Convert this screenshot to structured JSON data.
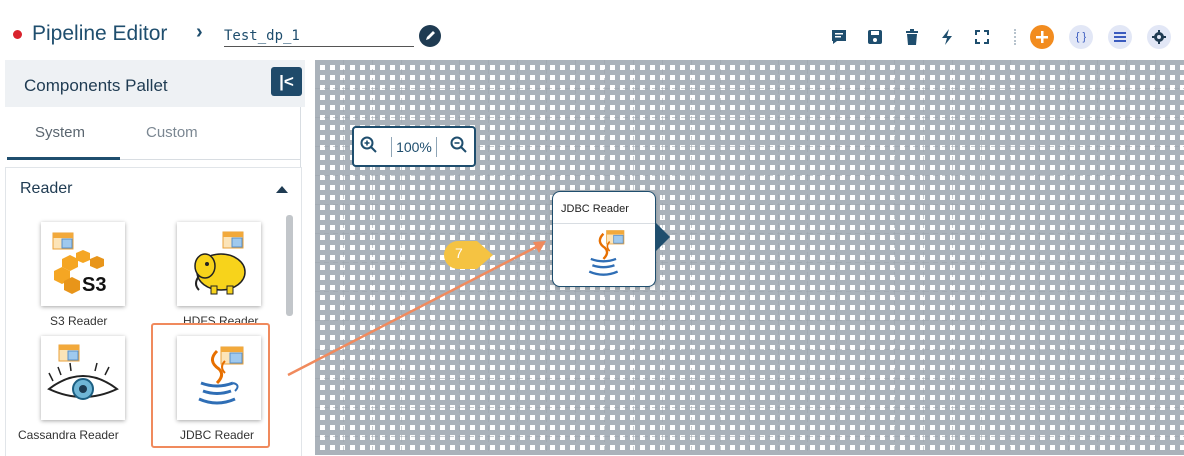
{
  "header": {
    "title": "Pipeline Editor",
    "pipeline_name": "Test_dp_1",
    "status_color": "#d9232d",
    "toolbar_icons": [
      "comment-icon",
      "save-icon",
      "delete-icon",
      "flash-icon",
      "fullscreen-icon",
      "add-icon",
      "json-icon",
      "list-icon",
      "settings-icon"
    ]
  },
  "sidebar": {
    "title": "Components Pallet",
    "collapse_label": "|<",
    "tabs": [
      {
        "label": "System",
        "active": true
      },
      {
        "label": "Custom",
        "active": false
      }
    ],
    "section_title": "Reader",
    "components": [
      {
        "label": "S3 Reader"
      },
      {
        "label": "HDFS Reader"
      },
      {
        "label": "Cassandra Reader"
      },
      {
        "label": "JDBC Reader"
      }
    ]
  },
  "canvas": {
    "zoom_level": "100%",
    "node": {
      "title": "JDBC Reader"
    },
    "step_number": "7"
  },
  "colors": {
    "accent": "#1f4e6e",
    "highlight": "#f08a5d",
    "step_bubble": "#f5c342"
  }
}
